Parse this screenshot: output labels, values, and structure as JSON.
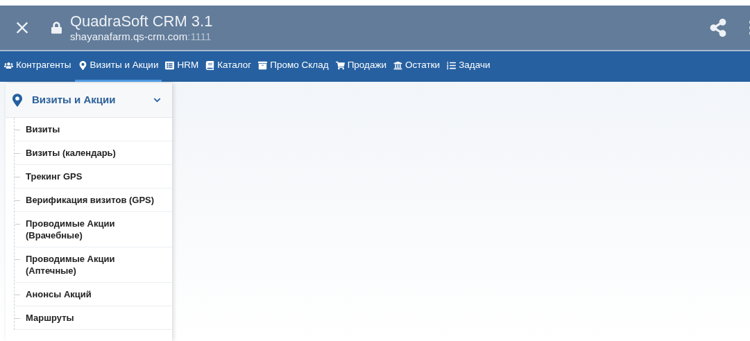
{
  "browser_bar": {
    "title": "QuadraSoft CRM 3.1",
    "url_host": "shayanafarm.qs-crm.com",
    "url_port": ":1111"
  },
  "nav_tabs": [
    {
      "label": "Контрагенты",
      "kind": "users",
      "selected": false
    },
    {
      "label": "Визиты и Акции",
      "kind": "marker",
      "selected": true
    },
    {
      "label": "HRM",
      "kind": "list",
      "selected": false
    },
    {
      "label": "Каталог",
      "kind": "book",
      "selected": false
    },
    {
      "label": "Промо Склад",
      "kind": "archive",
      "selected": false
    },
    {
      "label": "Продажи",
      "kind": "cart",
      "selected": false
    },
    {
      "label": "Остатки",
      "kind": "bank",
      "selected": false
    },
    {
      "label": "Задачи",
      "kind": "ordered",
      "selected": false
    }
  ],
  "side_menu": {
    "title": "Визиты и Акции",
    "expanded": true,
    "items": [
      "Визиты",
      "Визиты (календарь)",
      "Трекинг GPS",
      "Верификация визитов (GPS)",
      "Проводимые Акции (Врачебные)",
      "Проводимые Акции (Аптечные)",
      "Анонсы Акций",
      "Маршруты"
    ]
  }
}
